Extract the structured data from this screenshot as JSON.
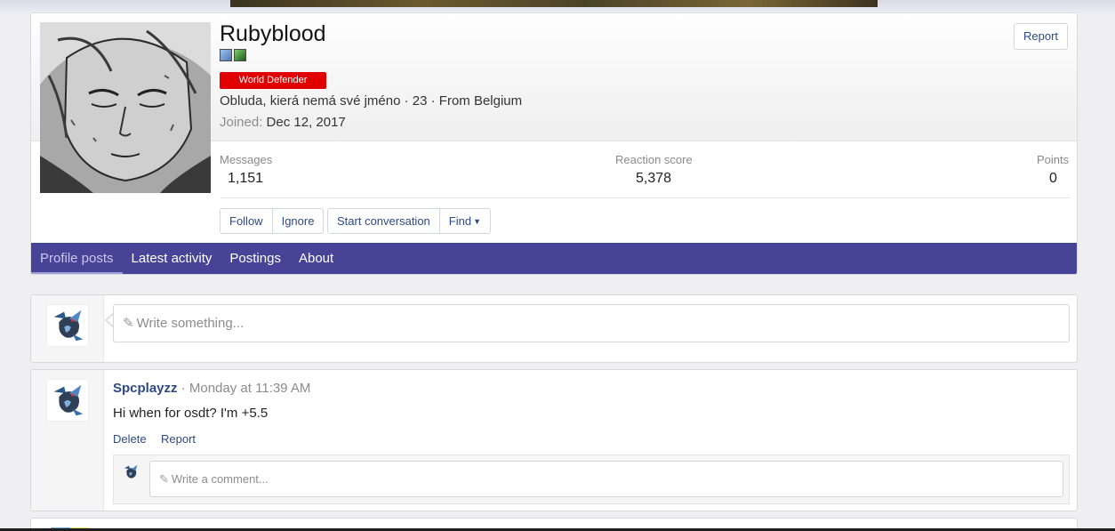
{
  "profile": {
    "username": "Rubyblood",
    "badges": [
      {
        "icon": "blue-badge-icon",
        "color": "#7fa6d8"
      },
      {
        "icon": "green-badge-icon",
        "color": "#3e8a3a"
      }
    ],
    "user_title": "World Defender",
    "user_title_color": "#e00000",
    "blurb": "Obluda, kierá nemá své jméno · 23 · From Belgium",
    "joined_label": "Joined:",
    "joined_date": "Dec 12, 2017",
    "report_label": "Report",
    "stats": {
      "messages_label": "Messages",
      "messages": "1,151",
      "reaction_label": "Reaction score",
      "reaction": "5,378",
      "points_label": "Points",
      "points": "0"
    },
    "actions": {
      "follow": "Follow",
      "ignore": "Ignore",
      "start_conversation": "Start conversation",
      "find": "Find"
    }
  },
  "tabs": [
    {
      "label": "Profile posts",
      "active": true
    },
    {
      "label": "Latest activity",
      "active": false
    },
    {
      "label": "Postings",
      "active": false
    },
    {
      "label": "About",
      "active": false
    }
  ],
  "composer": {
    "placeholder": "Write something..."
  },
  "post": {
    "author": "Spcplayzz",
    "separator": " · ",
    "time": "Monday at 11:39 AM",
    "text": "Hi when for osdt? I'm +5.5",
    "delete_label": "Delete",
    "report_label": "Report",
    "comment_placeholder": "Write a comment..."
  },
  "colors": {
    "accent": "#474397",
    "link": "#2d4a84"
  }
}
